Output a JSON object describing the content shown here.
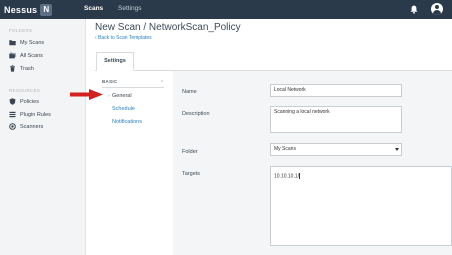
{
  "topbar": {
    "logo_text": "Nessus",
    "logo_badge": "N",
    "nav_scans": "Scans",
    "nav_settings": "Settings"
  },
  "sidebar": {
    "heading_folders": "FOLDERS",
    "heading_resources": "RESOURCES",
    "folder_items": [
      {
        "label": "My Scans",
        "icon": "folder-icon"
      },
      {
        "label": "All Scans",
        "icon": "folders-icon"
      },
      {
        "label": "Trash",
        "icon": "trash-icon"
      }
    ],
    "resource_items": [
      {
        "label": "Policies",
        "icon": "policies-icon"
      },
      {
        "label": "Plugin Rules",
        "icon": "plugin-rules-icon"
      },
      {
        "label": "Scanners",
        "icon": "scanners-icon"
      }
    ]
  },
  "main": {
    "title": "New Scan / NetworkScan_Policy",
    "back_link": "‹ Back to Scan Templates",
    "tab_settings": "Settings"
  },
  "settings_nav": {
    "section": "BASIC",
    "items": [
      "General",
      "Schedule",
      "Notifications"
    ]
  },
  "form": {
    "name_label": "Name",
    "name_value": "Local Network",
    "description_label": "Description",
    "description_value": "Scanning a local network",
    "folder_label": "Folder",
    "folder_value": "My Scans",
    "targets_label": "Targets",
    "targets_value": "10.10.10.1/"
  },
  "colors": {
    "topbar": "#2b3a4a",
    "link": "#2c7fc1",
    "annotation_arrow": "#d32020"
  }
}
